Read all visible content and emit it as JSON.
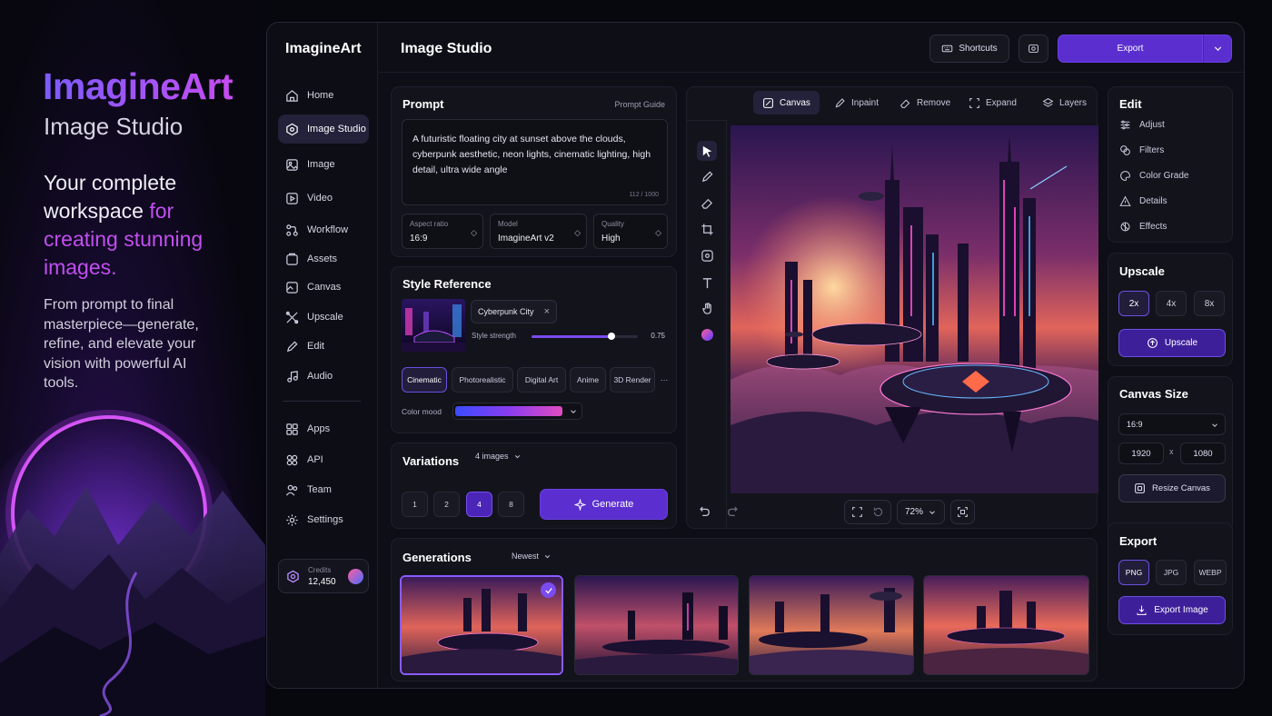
{
  "hero": {
    "brand": "ImagineArt",
    "subtitle": "Image Studio",
    "tagline_a": "Your complete workspace ",
    "tagline_b": "for creating stunning images.",
    "description": "From prompt to final masterpiece—generate, refine, and elevate your vision with powerful AI tools."
  },
  "sidebar": {
    "logo": "ImagineArt",
    "items": [
      {
        "label": "Home",
        "icon": "home-icon"
      },
      {
        "label": "Image Studio",
        "icon": "image-studio-icon"
      },
      {
        "label": "Image",
        "icon": "image-icon"
      },
      {
        "label": "Video",
        "icon": "video-icon"
      },
      {
        "label": "Workflow",
        "icon": "workflow-icon"
      },
      {
        "label": "Assets",
        "icon": "assets-icon"
      },
      {
        "label": "Canvas",
        "icon": "canvas-icon"
      },
      {
        "label": "Upscale",
        "icon": "upscale-icon"
      },
      {
        "label": "Edit",
        "icon": "edit-icon"
      },
      {
        "label": "Audio",
        "icon": "audio-icon"
      }
    ],
    "bottom_items": [
      {
        "label": "Apps",
        "icon": "apps-icon"
      },
      {
        "label": "API",
        "icon": "api-icon"
      },
      {
        "label": "Team",
        "icon": "team-icon"
      },
      {
        "label": "Settings",
        "icon": "settings-icon"
      }
    ],
    "active": "Image Studio",
    "credits": {
      "label": "Credits",
      "value": "12,450"
    }
  },
  "header": {
    "title": "Image Studio",
    "shortcuts": "Shortcuts",
    "export": "Export"
  },
  "prompt": {
    "title": "Prompt",
    "guide": "Prompt Guide",
    "text": "A futuristic floating city at sunset above the clouds, cyberpunk aesthetic, neon lights, cinematic lighting, high detail, ultra wide angle",
    "count": "112 / 1000",
    "aspect": {
      "label": "Aspect ratio",
      "value": "16:9"
    },
    "model": {
      "label": "Model",
      "value": "ImagineArt v2"
    },
    "quality": {
      "label": "Quality",
      "value": "High"
    }
  },
  "style": {
    "title": "Style Reference",
    "ref_name": "Cyberpunk City",
    "strength_label": "Style strength",
    "strength_value": "0.75",
    "strength": 0.75,
    "chips": [
      "Cinematic",
      "Photorealistic",
      "Digital Art",
      "Anime",
      "3D Render",
      "···"
    ],
    "active_chip": "Cinematic",
    "color_mood_label": "Color mood"
  },
  "variations": {
    "title": "Variations",
    "dropdown": "4 images",
    "options": [
      "1",
      "2",
      "4",
      "8"
    ],
    "selected": "4",
    "generate": "Generate"
  },
  "canvas": {
    "tabs": [
      "Canvas",
      "Inpaint",
      "Remove",
      "Expand",
      "Layers"
    ],
    "active_tab": "Canvas",
    "zoom": "72%"
  },
  "edit_panel": {
    "title": "Edit",
    "items": [
      "Adjust",
      "Filters",
      "Color Grade",
      "Details",
      "Effects"
    ]
  },
  "upscale": {
    "title": "Upscale",
    "options": [
      "2x",
      "4x",
      "8x"
    ],
    "selected": "2x",
    "button": "Upscale"
  },
  "canvas_size": {
    "title": "Canvas Size",
    "ratio": "16:9",
    "width": "1920",
    "x": "x",
    "height": "1080",
    "button": "Resize Canvas"
  },
  "export_panel": {
    "title": "Export",
    "formats": [
      "PNG",
      "JPG",
      "WEBP"
    ],
    "selected": "PNG",
    "button": "Export Image"
  },
  "generations": {
    "title": "Generations",
    "sort": "Newest"
  },
  "colors": {
    "accent": "#5b2fcf",
    "accent_light": "#8a5cff",
    "highlight": "#c24ff0",
    "bg": "#0e0e17"
  }
}
